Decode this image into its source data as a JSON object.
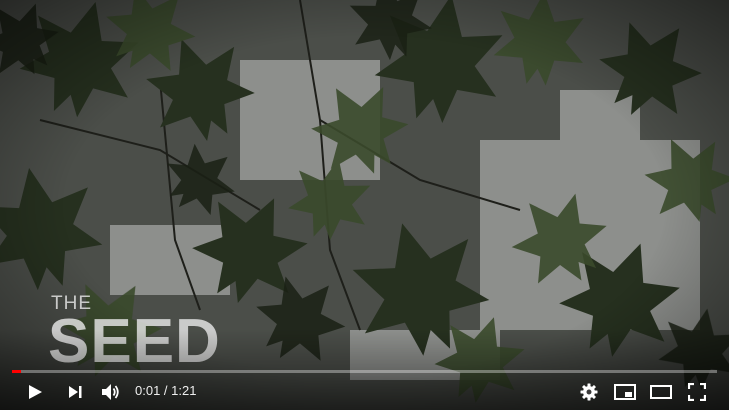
{
  "video": {
    "title_small": "THE",
    "title_large": "SEED",
    "progress_fraction": 0.0123
  },
  "controls": {
    "current_time": "0:01",
    "separator": " / ",
    "duration": "1:21",
    "icons": [
      "play-icon",
      "next-icon",
      "volume-icon",
      "settings-icon",
      "miniplayer-icon",
      "theater-mode-icon",
      "fullscreen-icon"
    ]
  },
  "colors": {
    "progress_played": "#ff0000",
    "controls_foreground": "#ffffff"
  }
}
